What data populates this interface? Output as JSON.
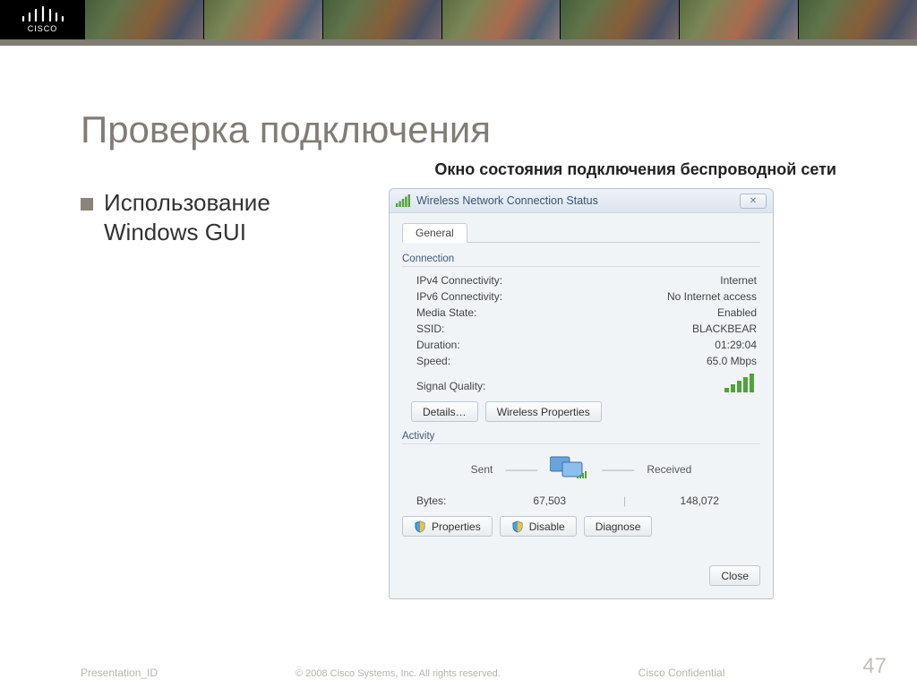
{
  "slide": {
    "title": "Проверка подключения",
    "subtitle": "Окно состояния подключения беспроводной сети",
    "bullet1": "Использование Windows GUI"
  },
  "dialog": {
    "title": "Wireless Network Connection Status",
    "close_icon": "✕",
    "tab_general": "General",
    "section_connection": "Connection",
    "ipv4_label": "IPv4 Connectivity:",
    "ipv4_value": "Internet",
    "ipv6_label": "IPv6 Connectivity:",
    "ipv6_value": "No Internet access",
    "media_label": "Media State:",
    "media_value": "Enabled",
    "ssid_label": "SSID:",
    "ssid_value": "BLACKBEAR",
    "duration_label": "Duration:",
    "duration_value": "01:29:04",
    "speed_label": "Speed:",
    "speed_value": "65.0 Mbps",
    "signal_label": "Signal Quality:",
    "btn_details": "Details…",
    "btn_wprops": "Wireless Properties",
    "section_activity": "Activity",
    "sent_label": "Sent",
    "received_label": "Received",
    "bytes_label": "Bytes:",
    "bytes_sent": "67,503",
    "bytes_recv": "148,072",
    "btn_props": "Properties",
    "btn_disable": "Disable",
    "btn_diag": "Diagnose",
    "btn_close": "Close"
  },
  "footer": {
    "left": "Presentation_ID",
    "mid": "© 2008 Cisco Systems, Inc. All rights reserved.",
    "right": "Cisco Confidential",
    "page": "47"
  },
  "brand": {
    "name": "CISCO"
  }
}
